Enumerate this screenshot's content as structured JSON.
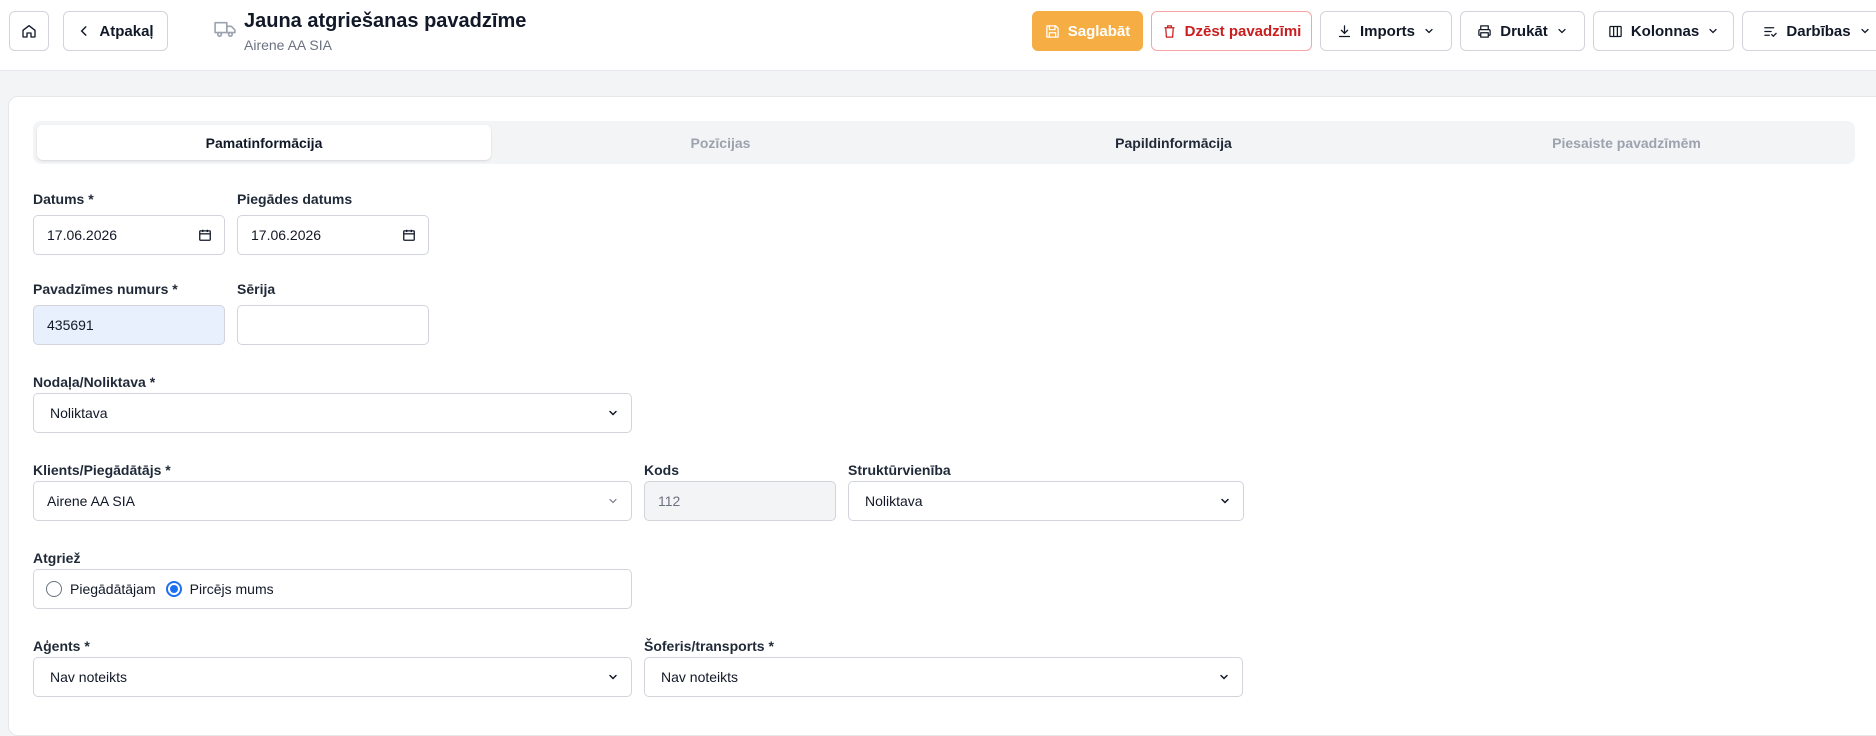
{
  "header": {
    "back_label": "Atpakaļ",
    "title": "Jauna atgriešanas pavadzīme",
    "subtitle": "Airene AA SIA",
    "save_label": "Saglabāt",
    "delete_label": "Dzēst pavadzīmi",
    "import_label": "Imports",
    "print_label": "Drukāt",
    "columns_label": "Kolonnas",
    "actions_label": "Darbības"
  },
  "tabs": [
    {
      "label": "Pamatinformācija",
      "active": true
    },
    {
      "label": "Pozīcijas",
      "active": false
    },
    {
      "label": "Papildinformācija",
      "active": false
    },
    {
      "label": "Piesaiste pavadzīmēm",
      "active": false
    }
  ],
  "form": {
    "date": {
      "label": "Datums *",
      "value": "17.06.2026"
    },
    "delivery_date": {
      "label": "Piegādes datums",
      "value": "17.06.2026"
    },
    "invoice_number": {
      "label": "Pavadzīmes numurs *",
      "value": "435691"
    },
    "series": {
      "label": "Sērija",
      "value": ""
    },
    "department": {
      "label": "Nodaļa/Noliktava *",
      "value": "Noliktava"
    },
    "client": {
      "label": "Klients/Piegādātājs *",
      "value": "Airene AA SIA"
    },
    "code": {
      "label": "Kods",
      "value": "112"
    },
    "structural_unit": {
      "label": "Struktūrvienība",
      "value": "Noliktava"
    },
    "returns": {
      "label": "Atgriež",
      "options": [
        {
          "label": "Piegādātājam",
          "checked": false
        },
        {
          "label": "Pircējs mums",
          "checked": true
        }
      ]
    },
    "agent": {
      "label": "Aģents *",
      "value": "Nav noteikts"
    },
    "driver": {
      "label": "Šoferis/transports *",
      "value": "Nav noteikts"
    }
  },
  "colors": {
    "save": "#f6ad43",
    "delete": "#c81e1e",
    "radio_accent": "#1d6ff2"
  }
}
